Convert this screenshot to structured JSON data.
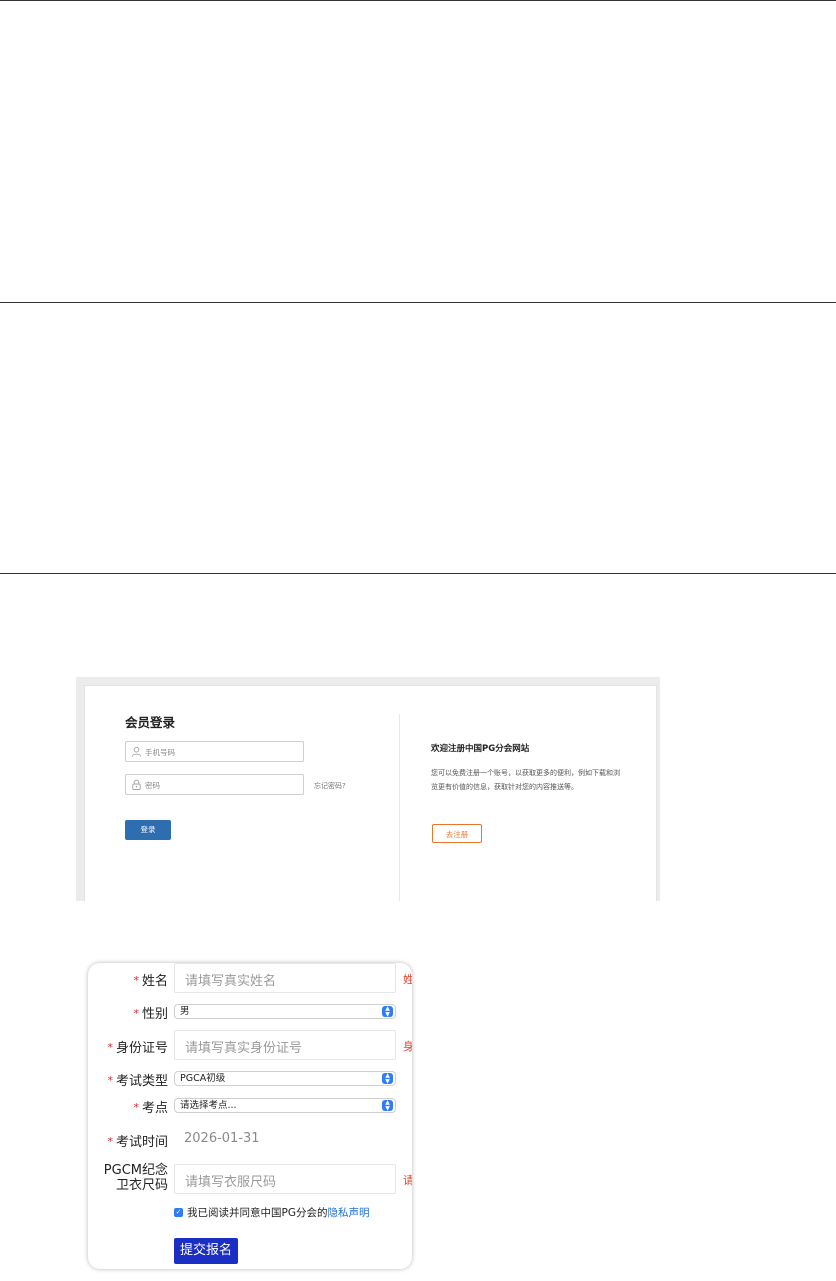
{
  "login": {
    "title": "会员登录",
    "phone_placeholder": "手机号码",
    "password_placeholder": "密码",
    "forgot_link": "忘记密码?",
    "login_button": "登录",
    "welcome_title": "欢迎注册中国PG分会网站",
    "welcome_text": "您可以免费注册一个账号，以获取更多的便利，例如下载和浏览更有价值的信息，获取针对您的内容推送等。",
    "register_button": "去注册"
  },
  "form": {
    "name": {
      "label": "姓名",
      "placeholder": "请填写真实姓名",
      "hint": "姓"
    },
    "gender": {
      "label": "性别",
      "value": "男"
    },
    "id_number": {
      "label": "身份证号",
      "placeholder": "请填写真实身份证号",
      "hint": "身"
    },
    "exam_type": {
      "label": "考试类型",
      "value": "PGCA初级"
    },
    "exam_site": {
      "label": "考点",
      "value": "请选择考点..."
    },
    "exam_time": {
      "label": "考试时间",
      "value": "2026-01-31"
    },
    "shirt_size": {
      "label_line1": "PGCM纪念",
      "label_line2": "卫衣尺码",
      "placeholder": "请填写衣服尺码",
      "hint": "请"
    },
    "agreement": {
      "text": "我已阅读并同意中国PG分会的",
      "link": "隐私声明"
    },
    "submit_button": "提交报名"
  },
  "colors": {
    "accent_blue": "#2e7cf6",
    "submit_blue": "#1c2fc4",
    "login_blue": "#2f6db1",
    "register_orange": "#e8772b",
    "required_red": "#d9262b"
  }
}
